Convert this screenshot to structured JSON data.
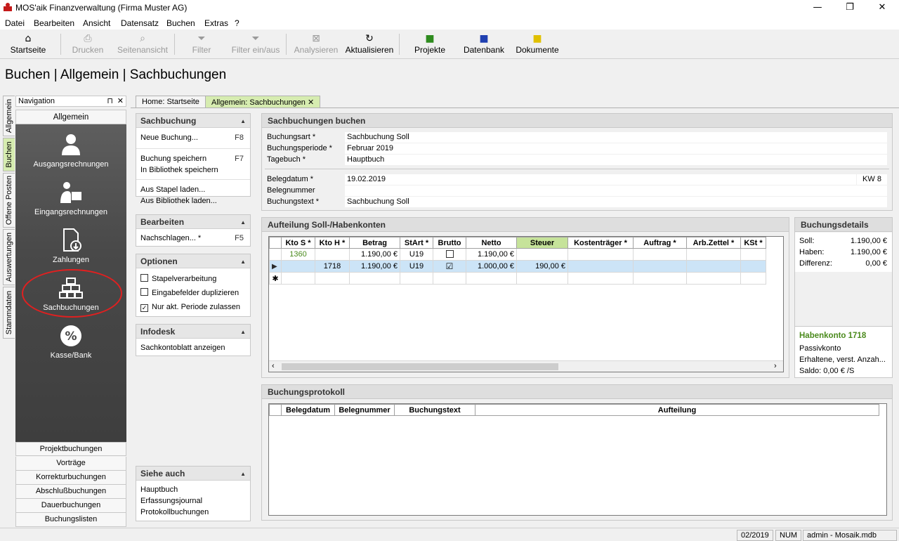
{
  "window": {
    "title": "MOS'aik Finanzverwaltung (Firma Muster AG)",
    "minimize": "—",
    "restore": "❐",
    "close": "✕"
  },
  "menu": [
    "Datei",
    "Bearbeiten",
    "Ansicht",
    "Datensatz",
    "Buchen",
    "Extras",
    "?"
  ],
  "toolbar": {
    "startseite": "Startseite",
    "drucken": "Drucken",
    "seitenansicht": "Seitenansicht",
    "filter": "Filter",
    "filter_toggle": "Filter ein/aus",
    "analysieren": "Analysieren",
    "aktualisieren": "Aktualisieren",
    "projekte": "Projekte",
    "datenbank": "Datenbank",
    "dokumente": "Dokumente"
  },
  "page_title": "Buchen | Allgemein | Sachbuchungen",
  "side_tabs": [
    "Allgemein",
    "Buchen",
    "Offene Posten",
    "Auswertungen",
    "Stammdaten"
  ],
  "navigation": {
    "header": "Navigation",
    "pin": "⊓",
    "close": "✕",
    "section": "Allgemein",
    "items": [
      "Ausgangsrechnungen",
      "Eingangsrechnungen",
      "Zahlungen",
      "Sachbuchungen",
      "Kasse/Bank"
    ],
    "bottom": [
      "Projektbuchungen",
      "Vorträge",
      "Korrekturbuchungen",
      "Abschlußbuchungen",
      "Dauerbuchungen",
      "Buchungslisten"
    ]
  },
  "doc_tabs": [
    "Home: Startseite",
    "Allgemein: Sachbuchungen"
  ],
  "tasks": {
    "sachbuchung": {
      "title": "Sachbuchung",
      "neue": "Neue Buchung...",
      "neue_key": "F8",
      "speichern": "Buchung speichern",
      "speichern_key": "F7",
      "bibliothek": "In Bibliothek speichern",
      "stapel": "Aus Stapel laden...",
      "bib_laden": "Aus Bibliothek laden..."
    },
    "bearbeiten": {
      "title": "Bearbeiten",
      "nachschlagen": "Nachschlagen... *",
      "key": "F5"
    },
    "optionen": {
      "title": "Optionen",
      "o1": "Stapelverarbeitung",
      "o2": "Eingabefelder duplizieren",
      "o3": "Nur akt. Periode zulassen",
      "o3_checked": "✓"
    },
    "infodesk": {
      "title": "Infodesk",
      "i1": "Sachkontoblatt anzeigen"
    },
    "siehe": {
      "title": "Siehe auch",
      "s1": "Hauptbuch",
      "s2": "Erfassungsjournal",
      "s3": "Protokollbuchungen"
    }
  },
  "form": {
    "title": "Sachbuchungen buchen",
    "buchungsart_label": "Buchungsart *",
    "buchungsart": "Sachbuchung Soll",
    "periode_label": "Buchungsperiode *",
    "periode": "Februar 2019",
    "tagebuch_label": "Tagebuch *",
    "tagebuch": "Hauptbuch",
    "belegdatum_label": "Belegdatum *",
    "belegdatum": "19.02.2019",
    "kw": "KW 8",
    "belegnummer_label": "Belegnummer",
    "belegnummer": "",
    "buchungstext_label": "Buchungstext *",
    "buchungstext": "Sachbuchung Soll"
  },
  "aufteilung": {
    "title": "Aufteilung Soll-/Habenkonten",
    "columns": [
      "Kto S *",
      "Kto H *",
      "Betrag",
      "StArt *",
      "Brutto",
      "Netto",
      "Steuer",
      "Kostenträger *",
      "Auftrag *",
      "Arb.Zettel *",
      "KSt *"
    ],
    "rows": [
      {
        "kto_s": "1360",
        "kto_h": "",
        "betrag": "1.190,00 €",
        "start": "U19",
        "brutto": "",
        "netto": "1.190,00 €",
        "steuer": ""
      },
      {
        "kto_s": "",
        "kto_h": "1718",
        "betrag": "1.190,00 €",
        "start": "U19",
        "brutto": "☑",
        "netto": "1.000,00 €",
        "steuer": "190,00 €"
      }
    ],
    "new_row_marker": "✱"
  },
  "details": {
    "title": "Buchungsdetails",
    "soll_label": "Soll:",
    "soll": "1.190,00 €",
    "haben_label": "Haben:",
    "haben": "1.190,00 €",
    "diff_label": "Differenz:",
    "diff": "0,00 €",
    "konto_title": "Habenkonto 1718",
    "konto_type": "Passivkonto",
    "konto_name": "Erhaltene, verst. Anzah...",
    "saldo": "Saldo: 0,00 € /S"
  },
  "protokoll": {
    "title": "Buchungsprotokoll",
    "columns": [
      "Belegdatum",
      "Belegnummer",
      "Buchungstext",
      "Aufteilung"
    ]
  },
  "status": {
    "period": "02/2019",
    "num": "NUM",
    "db": "admin - Mosaik.mdb"
  },
  "colors": {
    "accent_green": "#d6ecb0",
    "steuer_header": "#c6e39a",
    "selected_row": "#cce4f7",
    "konto_green": "#4a8a1c",
    "highlight_circle": "#e02020"
  }
}
